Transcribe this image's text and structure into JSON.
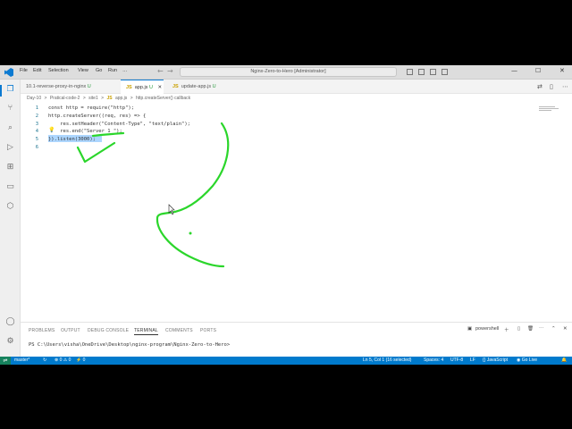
{
  "titlebar": {
    "menu": [
      "File",
      "Edit",
      "Selection",
      "View",
      "Go",
      "Run",
      "…"
    ],
    "command_center": "Nginx-Zero-to-Hero [Administrator]",
    "minimize": "—",
    "maximize": "☐",
    "close": "✕"
  },
  "tabs": [
    {
      "label": "10.1-reverse-proxy-in-nginx",
      "badge": "U",
      "kind": "nginx"
    },
    {
      "label": "app.js",
      "badge": "U",
      "kind": "js",
      "close": "✕"
    },
    {
      "label": "update-app.js",
      "badge": "U",
      "kind": "js"
    }
  ],
  "breadcrumb": [
    "Day-10",
    ">",
    "Pratical-code-2",
    ">",
    "site1",
    ">",
    "JS",
    "app.js",
    ">",
    "http.createServer() callback"
  ],
  "editor": {
    "lines": [
      {
        "n": "1",
        "text": "const http = require(\"http\");"
      },
      {
        "n": "2",
        "text": "http.createServer((req, res) => {"
      },
      {
        "n": "3",
        "text": "    res.setHeader(\"Content-Type\", \"text/plain\");"
      },
      {
        "n": "4",
        "text": "    res.end(\"Server 1 \");"
      },
      {
        "n": "5",
        "text": "}).listen(3000);"
      },
      {
        "n": "6",
        "text": ""
      }
    ]
  },
  "panel": {
    "tabs": [
      "PROBLEMS",
      "OUTPUT",
      "DEBUG CONSOLE",
      "TERMINAL",
      "COMMENTS",
      "PORTS"
    ],
    "active_tab": "TERMINAL",
    "shell": "powershell",
    "terminal_prompt": "PS C:\\Users\\visha\\OneDrive\\Desktop\\nginx-program\\Nginx-Zero-to-Hero>"
  },
  "statusbar": {
    "branch": "master*",
    "problems": "⊗ 0 ⚠ 0",
    "ports": "⚡ 0",
    "position": "Ln 5, Col 1 (16 selected)",
    "spaces": "Spaces: 4",
    "encoding": "UTF-8",
    "eol": "LF",
    "language": "{} JavaScript",
    "golive": "Go Live"
  },
  "colors": {
    "statusbar": "#007acc",
    "accent": "#0b7ad1",
    "annotation_ink": "#2bd62b"
  }
}
